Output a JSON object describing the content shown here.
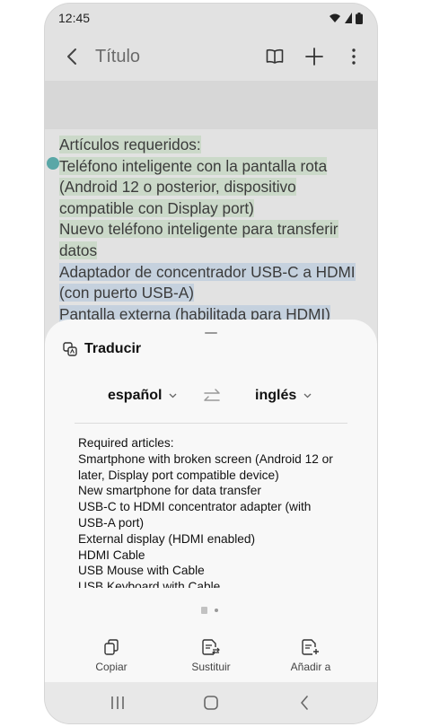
{
  "status_bar": {
    "time": "12:45"
  },
  "app_bar": {
    "title": "Título"
  },
  "note": {
    "lines": [
      "Artículos requeridos:",
      "Teléfono inteligente con la pantalla rota",
      "(Android 12 o posterior, dispositivo",
      "compatible con Display port)",
      "Nuevo teléfono inteligente para transferir",
      "datos",
      "Adaptador de concentrador USB-C a HDMI",
      "(con puerto USB-A)",
      "Pantalla externa (habilitada para HDMI)"
    ]
  },
  "translate_sheet": {
    "title": "Traducir",
    "source_language": "español",
    "target_language": "inglés",
    "result_lines": [
      "Required articles:",
      "Smartphone with broken screen (Android 12 or",
      "later, Display port compatible device)",
      "New smartphone for data transfer",
      "USB-C to HDMI concentrator adapter (with",
      "USB-A port)",
      "External display (HDMI enabled)",
      "HDMI Cable",
      "USB Mouse with Cable",
      "USB Keyboard with Cable"
    ],
    "actions": {
      "copy": "Copiar",
      "replace": "Sustituir",
      "add_to": "Añadir a"
    }
  },
  "icons": [
    "wifi-icon",
    "signal-icon",
    "battery-icon",
    "back-icon",
    "book-icon",
    "plus-icon",
    "more-icon",
    "translate-icon",
    "chevron-down-icon",
    "swap-icon",
    "copy-icon",
    "replace-icon",
    "add-to-icon",
    "recents-icon",
    "home-icon",
    "nav-back-icon"
  ]
}
